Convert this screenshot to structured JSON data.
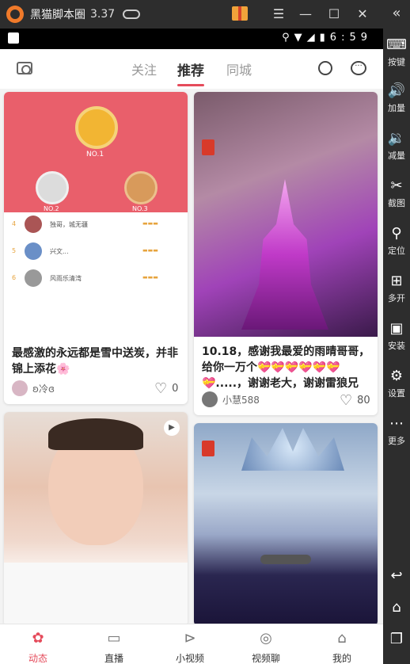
{
  "emulator": {
    "name": "黑猫脚本圈",
    "version": "3.37",
    "side_buttons": [
      {
        "label": "按键",
        "icon": "keyboard-icon"
      },
      {
        "label": "加量",
        "icon": "volume-up-icon"
      },
      {
        "label": "减量",
        "icon": "volume-down-icon"
      },
      {
        "label": "截图",
        "icon": "scissors-icon"
      },
      {
        "label": "定位",
        "icon": "location-pin-icon"
      },
      {
        "label": "多开",
        "icon": "multi-window-icon"
      },
      {
        "label": "安装",
        "icon": "apk-install-icon"
      },
      {
        "label": "设置",
        "icon": "gear-icon"
      },
      {
        "label": "更多",
        "icon": "more-dots-icon"
      }
    ]
  },
  "status_bar": {
    "time": "6:59"
  },
  "topnav": {
    "tabs": [
      "关注",
      "推荐",
      "同城"
    ],
    "active_tab": "推荐"
  },
  "cards": [
    {
      "title": "最感激的永远都是雪中送炭，并非锦上添花🌸",
      "author": "ʚ冷ɞ",
      "likes": "0",
      "rank_image": {
        "labels": [
          "NO.1",
          "NO.2",
          "NO.3"
        ],
        "rows": [
          {
            "rank": "4",
            "name": "独哥，城无疆"
          },
          {
            "rank": "5",
            "name": "兴文..."
          },
          {
            "rank": "6",
            "name": "风雨乐清湾"
          }
        ]
      }
    },
    {
      "title": "10.18，感谢我最爱的雨晴哥哥，给你一万个💝💝💝💝💝💝💝.....，谢谢老大，谢谢雷狼兄",
      "author": "小慧588",
      "likes": "80"
    },
    {
      "title": "",
      "author": "",
      "likes": ""
    },
    {
      "title": "",
      "author": "",
      "likes": ""
    }
  ],
  "bottomnav": {
    "items": [
      "动态",
      "直播",
      "小视频",
      "视频聊",
      "我的"
    ],
    "active": "动态"
  },
  "colors": {
    "accent": "#e54b5b",
    "rank_bg": "#e95f6b",
    "gold": "#e7a43e"
  }
}
